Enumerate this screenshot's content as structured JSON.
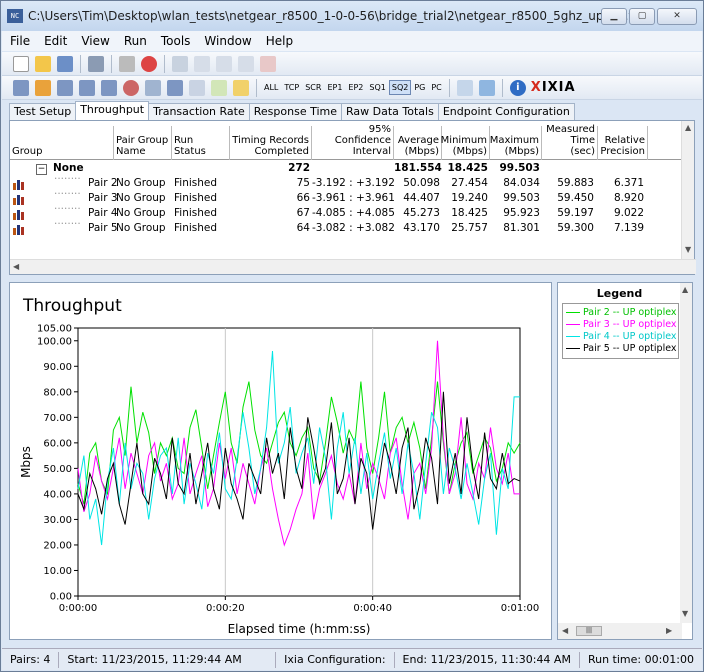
{
  "window": {
    "title": "C:\\Users\\Tim\\Desktop\\wlan_tests\\netgear_r8500_1-0-0-56\\bridge_trial2\\netgear_r8500_5ghz_uplink.tst",
    "icon_text": "NC"
  },
  "menu": [
    "File",
    "Edit",
    "View",
    "Run",
    "Tools",
    "Window",
    "Help"
  ],
  "toolbar2": {
    "labels": [
      "ALL",
      "TCP",
      "SCR",
      "EP1",
      "EP2",
      "SQ1",
      "SQ2",
      "PG",
      "PC"
    ],
    "active": "SQ2",
    "brand": "XIXIA"
  },
  "tabs": [
    "Test Setup",
    "Throughput",
    "Transaction Rate",
    "Response Time",
    "Raw Data Totals",
    "Endpoint Configuration"
  ],
  "selected_tab": "Throughput",
  "table": {
    "headers": [
      "Group",
      "Pair Group Name",
      "Run Status",
      "Timing Records Completed",
      "95% Confidence Interval",
      "Average (Mbps)",
      "Minimum (Mbps)",
      "Maximum (Mbps)",
      "Measured Time (sec)",
      "Relative Precision"
    ],
    "group_row": {
      "expand": "−",
      "name": "None",
      "records": "272",
      "avg": "181.554",
      "min": "18.425",
      "max": "99.503"
    },
    "rows": [
      {
        "pair": "Pair 2",
        "pgname": "No Group",
        "status": "Finished",
        "records": "75",
        "ci": "-3.192 : +3.192",
        "avg": "50.098",
        "min": "27.454",
        "max": "84.034",
        "time": "59.883",
        "prec": "6.371"
      },
      {
        "pair": "Pair 3",
        "pgname": "No Group",
        "status": "Finished",
        "records": "66",
        "ci": "-3.961 : +3.961",
        "avg": "44.407",
        "min": "19.240",
        "max": "99.503",
        "time": "59.450",
        "prec": "8.920"
      },
      {
        "pair": "Pair 4",
        "pgname": "No Group",
        "status": "Finished",
        "records": "67",
        "ci": "-4.085 : +4.085",
        "avg": "45.273",
        "min": "18.425",
        "max": "95.923",
        "time": "59.197",
        "prec": "9.022"
      },
      {
        "pair": "Pair 5",
        "pgname": "No Group",
        "status": "Finished",
        "records": "64",
        "ci": "-3.082 : +3.082",
        "avg": "43.170",
        "min": "25.757",
        "max": "81.301",
        "time": "59.300",
        "prec": "7.139"
      }
    ]
  },
  "legend": {
    "title": "Legend",
    "items": [
      {
        "label": "Pair 2 -- UP optiplex",
        "color": "#00e000"
      },
      {
        "label": "Pair 3 -- UP optiplex",
        "color": "#ff00ff"
      },
      {
        "label": "Pair 4 -- UP optiplex",
        "color": "#00e5e5"
      },
      {
        "label": "Pair 5 -- UP optiplex",
        "color": "#000000"
      }
    ]
  },
  "chart_data": {
    "type": "line",
    "title": "Throughput",
    "xlabel": "Elapsed time (h:mm:ss)",
    "ylabel": "Mbps",
    "xlim": [
      0,
      60
    ],
    "ylim": [
      0,
      105
    ],
    "yticks": [
      0,
      10,
      20,
      30,
      40,
      50,
      60,
      70,
      80,
      90,
      100,
      105
    ],
    "ytick_labels": [
      "0.00",
      "10.00",
      "20.00",
      "30.00",
      "40.00",
      "50.00",
      "60.00",
      "70.00",
      "80.00",
      "90.00",
      "100.00",
      "105.00"
    ],
    "xticks": [
      0,
      20,
      40,
      60
    ],
    "xtick_labels": [
      "0:00:00",
      "0:00:20",
      "0:00:40",
      "0:01:00"
    ],
    "series": [
      {
        "name": "Pair 2 -- UP optiplex",
        "color": "#00e000",
        "x": [
          0,
          0.8,
          1.6,
          2.4,
          3.2,
          4,
          4.8,
          5.6,
          6.4,
          7.2,
          8,
          8.8,
          9.6,
          10.4,
          11.2,
          12,
          12.8,
          13.6,
          14.4,
          15.2,
          16,
          16.8,
          17.6,
          18.4,
          19.2,
          20,
          20.8,
          21.6,
          22.4,
          23.2,
          24,
          24.8,
          25.6,
          26.4,
          27.2,
          28,
          28.8,
          29.6,
          30.4,
          31.2,
          32,
          32.8,
          33.6,
          34.4,
          35.2,
          36,
          36.8,
          37.6,
          38.4,
          39.2,
          40,
          40.8,
          41.6,
          42.4,
          43.2,
          44,
          44.8,
          45.6,
          46.4,
          47.2,
          48,
          48.8,
          49.6,
          50.4,
          51.2,
          52,
          52.8,
          53.6,
          54.4,
          55.2,
          56,
          56.8,
          57.6,
          58.4,
          59.2,
          60
        ],
        "y": [
          44,
          36,
          56,
          60,
          45,
          40,
          65,
          70,
          55,
          82,
          60,
          72,
          64,
          48,
          60,
          55,
          62,
          50,
          48,
          66,
          73,
          58,
          42,
          55,
          68,
          80,
          60,
          52,
          74,
          84,
          65,
          55,
          52,
          60,
          68,
          72,
          60,
          55,
          62,
          66,
          50,
          45,
          60,
          78,
          68,
          56,
          65,
          60,
          84,
          58,
          48,
          62,
          80,
          56,
          66,
          70,
          60,
          68,
          58,
          42,
          62,
          84,
          60,
          40,
          52,
          60,
          64,
          48,
          55,
          62,
          58,
          45,
          50,
          60,
          56,
          60
        ]
      },
      {
        "name": "Pair 3 -- UP optiplex",
        "color": "#ff00ff",
        "x": [
          0,
          0.8,
          1.6,
          2.4,
          3.2,
          4,
          4.8,
          5.6,
          6.4,
          7.2,
          8,
          8.8,
          9.6,
          10.4,
          11.2,
          12,
          12.8,
          13.6,
          14.4,
          15.2,
          16,
          16.8,
          17.6,
          18.4,
          19.2,
          20,
          20.8,
          21.6,
          22.4,
          23.2,
          24,
          24.8,
          25.6,
          26.4,
          27.2,
          28,
          28.8,
          29.6,
          30.4,
          31.2,
          32,
          32.8,
          33.6,
          34.4,
          35.2,
          36,
          36.8,
          37.6,
          38.4,
          39.2,
          40,
          40.8,
          41.6,
          42.4,
          43.2,
          44,
          44.8,
          45.6,
          46.4,
          47.2,
          48,
          48.8,
          49.6,
          50.4,
          51.2,
          52,
          52.8,
          53.6,
          54.4,
          55.2,
          56,
          56.8,
          57.6,
          58.4,
          59.2,
          60
        ],
        "y": [
          50,
          33,
          40,
          55,
          45,
          38,
          50,
          62,
          42,
          56,
          48,
          40,
          55,
          60,
          45,
          52,
          38,
          44,
          62,
          40,
          48,
          55,
          35,
          42,
          60,
          46,
          58,
          40,
          52,
          44,
          36,
          50,
          58,
          42,
          30,
          20,
          26,
          34,
          40,
          56,
          30,
          42,
          48,
          55,
          44,
          38,
          48,
          36,
          60,
          42,
          52,
          46,
          38,
          56,
          62,
          44,
          30,
          48,
          52,
          40,
          58,
          100,
          62,
          40,
          48,
          70,
          44,
          38,
          52,
          46,
          66,
          50,
          44,
          56,
          40,
          40
        ]
      },
      {
        "name": "Pair 4 -- UP optiplex",
        "color": "#00e5e5",
        "x": [
          0,
          0.8,
          1.6,
          2.4,
          3.2,
          4,
          4.8,
          5.6,
          6.4,
          7.2,
          8,
          8.8,
          9.6,
          10.4,
          11.2,
          12,
          12.8,
          13.6,
          14.4,
          15.2,
          16,
          16.8,
          17.6,
          18.4,
          19.2,
          20,
          20.8,
          21.6,
          22.4,
          23.2,
          24,
          24.8,
          25.6,
          26.4,
          27.2,
          28,
          28.8,
          29.6,
          30.4,
          31.2,
          32,
          32.8,
          33.6,
          34.4,
          35.2,
          36,
          36.8,
          37.6,
          38.4,
          39.2,
          40,
          40.8,
          41.6,
          42.4,
          43.2,
          44,
          44.8,
          45.6,
          46.4,
          47.2,
          48,
          48.8,
          49.6,
          50.4,
          51.2,
          52,
          52.8,
          53.6,
          54.4,
          55.2,
          56,
          56.8,
          57.6,
          58.4,
          59.2,
          60
        ],
        "y": [
          42,
          55,
          30,
          38,
          20,
          45,
          58,
          36,
          60,
          42,
          52,
          48,
          30,
          46,
          55,
          58,
          40,
          62,
          36,
          52,
          44,
          34,
          56,
          48,
          64,
          42,
          38,
          54,
          72,
          58,
          40,
          50,
          66,
          96,
          52,
          60,
          74,
          48,
          56,
          62,
          44,
          66,
          54,
          30,
          58,
          72,
          48,
          62,
          40,
          56,
          38,
          52,
          64,
          46,
          58,
          40,
          60,
          48,
          30,
          52,
          72,
          66,
          40,
          58,
          50,
          38,
          52,
          40,
          28,
          46,
          56,
          24,
          50,
          42,
          78,
          78
        ]
      },
      {
        "name": "Pair 5 -- UP optiplex",
        "color": "#000000",
        "x": [
          0,
          0.8,
          1.6,
          2.4,
          3.2,
          4,
          4.8,
          5.6,
          6.4,
          7.2,
          8,
          8.8,
          9.6,
          10.4,
          11.2,
          12,
          12.8,
          13.6,
          14.4,
          15.2,
          16,
          16.8,
          17.6,
          18.4,
          19.2,
          20,
          20.8,
          21.6,
          22.4,
          23.2,
          24,
          24.8,
          25.6,
          26.4,
          27.2,
          28,
          28.8,
          29.6,
          30.4,
          31.2,
          32,
          32.8,
          33.6,
          34.4,
          35.2,
          36,
          36.8,
          37.6,
          38.4,
          39.2,
          40,
          40.8,
          41.6,
          42.4,
          43.2,
          44,
          44.8,
          45.6,
          46.4,
          47.2,
          48,
          48.8,
          49.6,
          50.4,
          51.2,
          52,
          52.8,
          53.6,
          54.4,
          55.2,
          56,
          56.8,
          57.6,
          58.4,
          59.2,
          60
        ],
        "y": [
          40,
          34,
          48,
          42,
          32,
          46,
          52,
          36,
          28,
          44,
          60,
          40,
          36,
          54,
          48,
          38,
          62,
          44,
          40,
          56,
          36,
          48,
          60,
          42,
          34,
          58,
          44,
          38,
          30,
          52,
          46,
          40,
          62,
          48,
          56,
          38,
          66,
          50,
          42,
          70,
          58,
          44,
          50,
          68,
          40,
          46,
          62,
          36,
          54,
          48,
          26,
          44,
          60,
          52,
          40,
          58,
          66,
          34,
          44,
          62,
          54,
          36,
          80,
          44,
          56,
          40,
          70,
          50,
          38,
          64,
          46,
          42,
          56,
          44,
          46,
          45
        ]
      }
    ],
    "legend_position": "right",
    "grid": true
  },
  "status": {
    "pairs": "Pairs: 4",
    "start": "Start: 11/23/2015, 11:29:44 AM",
    "config": "Ixia Configuration:",
    "end": "End: 11/23/2015, 11:30:44 AM",
    "runtime": "Run time: 00:01:00"
  }
}
